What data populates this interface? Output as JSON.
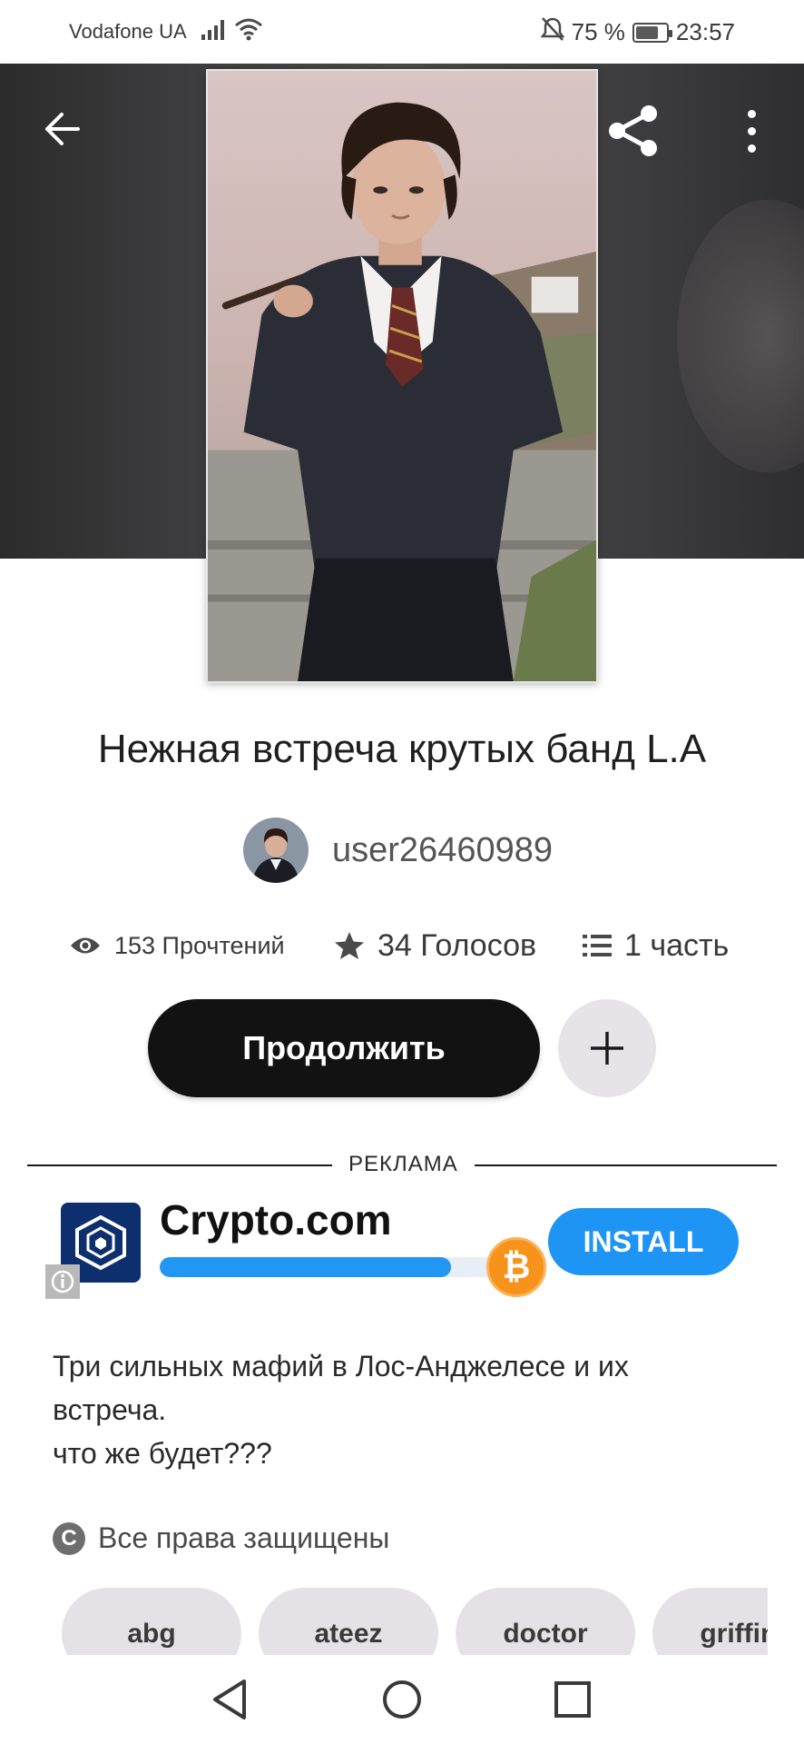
{
  "status_bar": {
    "carrier": "Vodafone UA",
    "battery_text": "75 %",
    "battery_level": 0.75,
    "time": "23:57",
    "icons": [
      "signal-icon",
      "wifi-icon",
      "alarm-off-icon",
      "battery-icon"
    ]
  },
  "header": {
    "icons": [
      "back-arrow-icon",
      "share-icon",
      "more-vert-icon"
    ]
  },
  "story": {
    "title": "Нежная встреча крутых банд L.A",
    "author": "user26460989",
    "reads": "153 Прочтений",
    "votes": "34 Голосов",
    "parts": "1 часть",
    "continue_label": "Продолжить",
    "description_lines": [
      "Три сильных мафий в Лос-Анджелесе и их",
      "встреча.",
      "что же будет???"
    ],
    "copyright": "Все права защищены",
    "tags": [
      "abg",
      "ateez",
      "doctor",
      "griffinj"
    ]
  },
  "ad": {
    "label": "РЕКЛАМА",
    "app_name": "Crypto.com",
    "install_label": "INSTALL",
    "progress": 0.82,
    "coin_symbol": "₿",
    "colors": {
      "button": "#1e94f4",
      "progress": "#2196f3",
      "coin": "#f7931a",
      "logo_bg": "#0d2f6e"
    }
  },
  "colors": {
    "continue_button": "#121212",
    "add_button": "#e6e4e8",
    "tag_bg": "#e4e2e6"
  }
}
